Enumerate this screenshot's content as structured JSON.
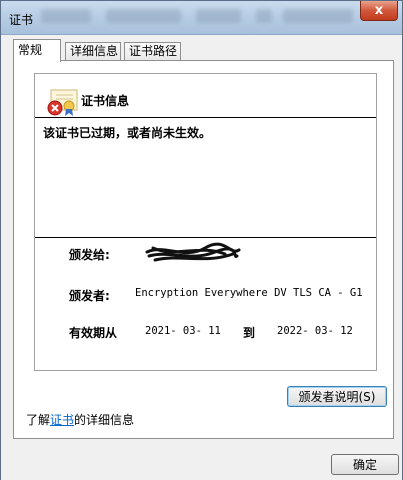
{
  "window": {
    "title": "证书",
    "close_glyph": "x"
  },
  "tabs": [
    {
      "label": "常规",
      "active": true
    },
    {
      "label": "详细信息",
      "active": false
    },
    {
      "label": "证书路径",
      "active": false
    }
  ],
  "cert": {
    "heading": "证书信息",
    "message": "该证书已过期，或者尚未生效。",
    "issued_to_label": "颁发给:",
    "issued_by_label": "颁发者:",
    "issued_by_value": "Encryption Everywhere DV TLS CA - G1",
    "validity_label": "有效期从",
    "valid_from": "2021- 03- 11",
    "to_label": "到",
    "valid_to": "2022- 03- 12"
  },
  "buttons": {
    "issuer_statement": "颁发者说明(S)",
    "ok": "确定"
  },
  "footer": {
    "learn_prefix": "了解",
    "learn_link": "证书",
    "learn_suffix": "的详细信息"
  },
  "colors": {
    "link": "#0066cc",
    "titlebar": "#b5cbe3",
    "close": "#d1583b"
  }
}
